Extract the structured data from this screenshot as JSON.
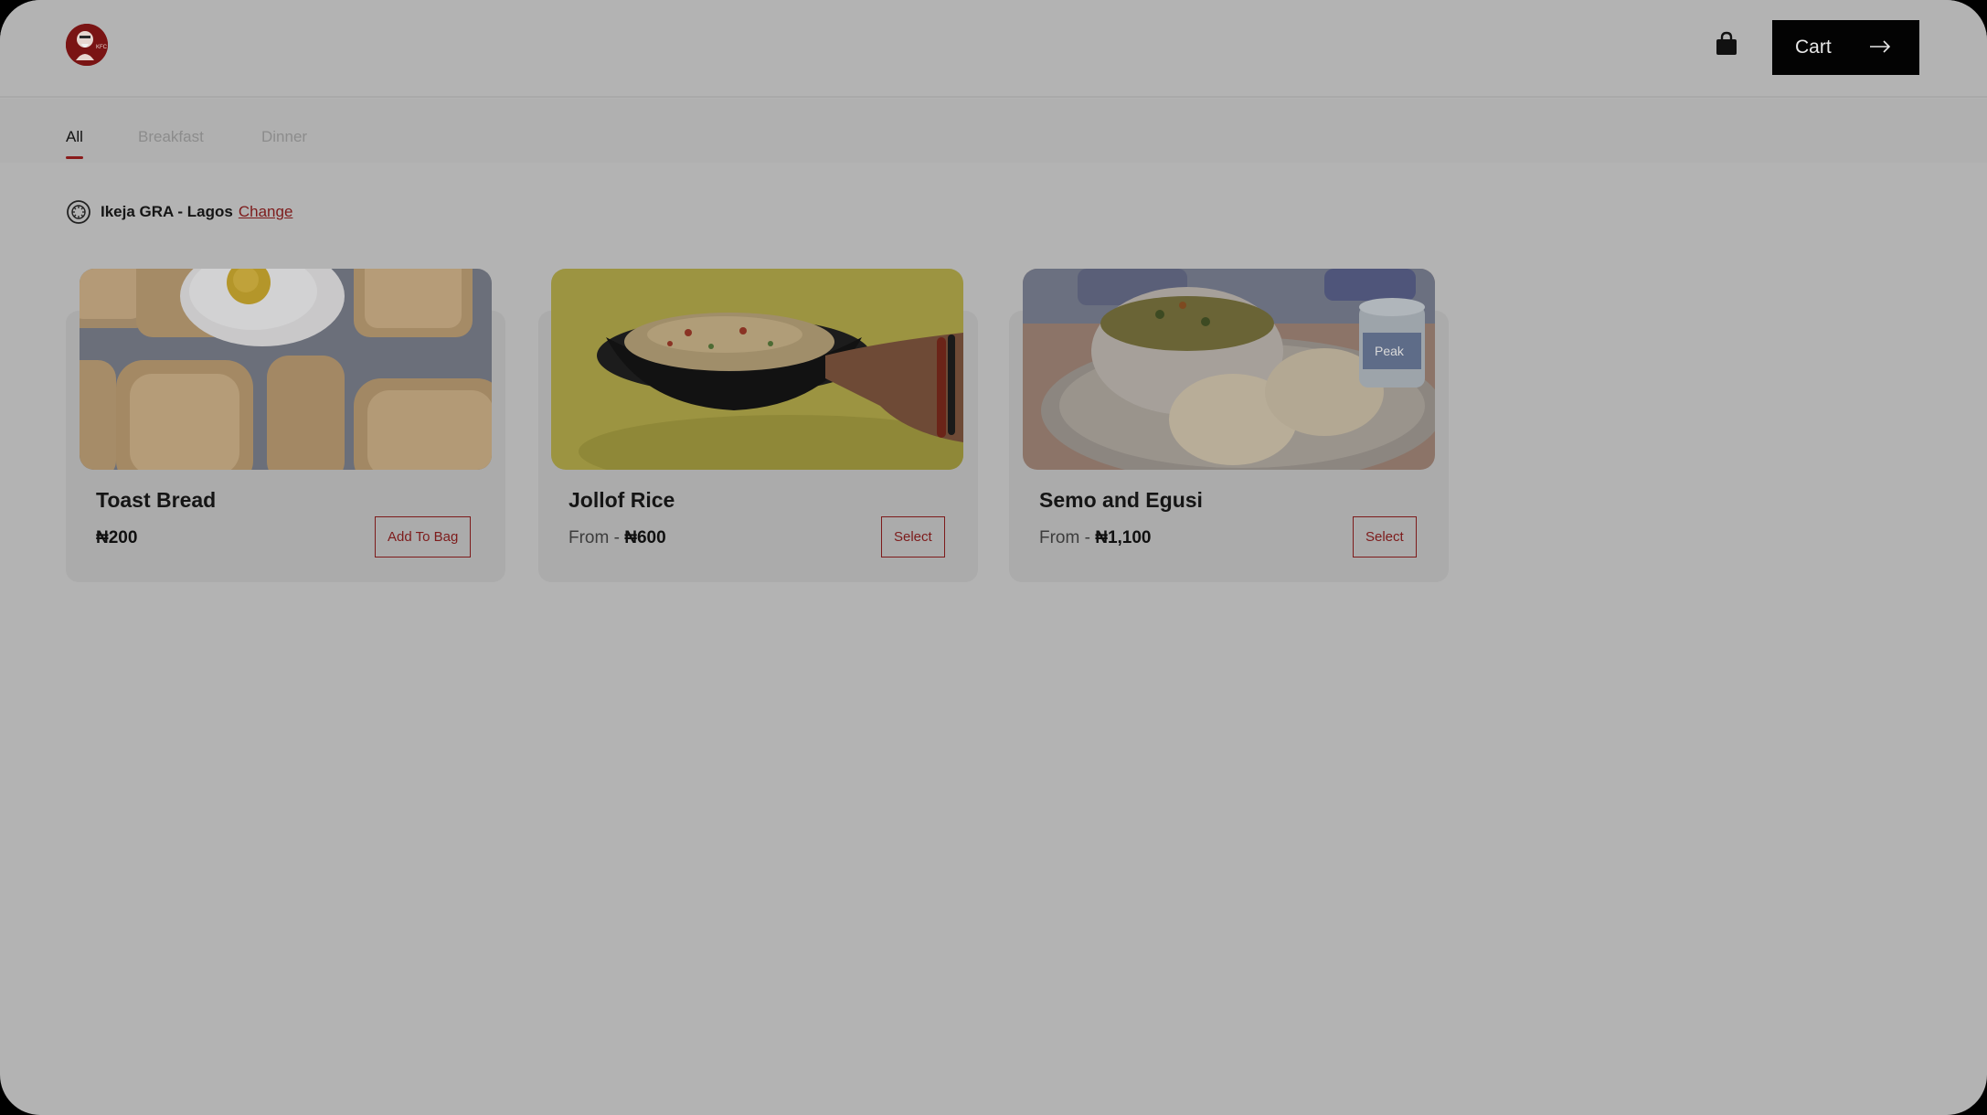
{
  "header": {
    "logo_alt": "KFC",
    "cart_label": "Cart"
  },
  "tabs": [
    {
      "label": "All",
      "active": true
    },
    {
      "label": "Breakfast",
      "active": false
    },
    {
      "label": "Dinner",
      "active": false
    }
  ],
  "location": {
    "name": "Ikeja GRA - Lagos",
    "change_label": "Change"
  },
  "products": [
    {
      "title": "Toast Bread",
      "price_prefix": "",
      "price": "₦200",
      "button_label": "Add To Bag"
    },
    {
      "title": "Jollof Rice",
      "price_prefix": "From - ",
      "price": "₦600",
      "button_label": "Select"
    },
    {
      "title": "Semo and Egusi",
      "price_prefix": "From - ",
      "price": "₦1,100",
      "button_label": "Select"
    }
  ],
  "colors": {
    "overlay": "#b3b3b3",
    "accent": "#7d1b1b",
    "cart_bg": "#030303"
  }
}
